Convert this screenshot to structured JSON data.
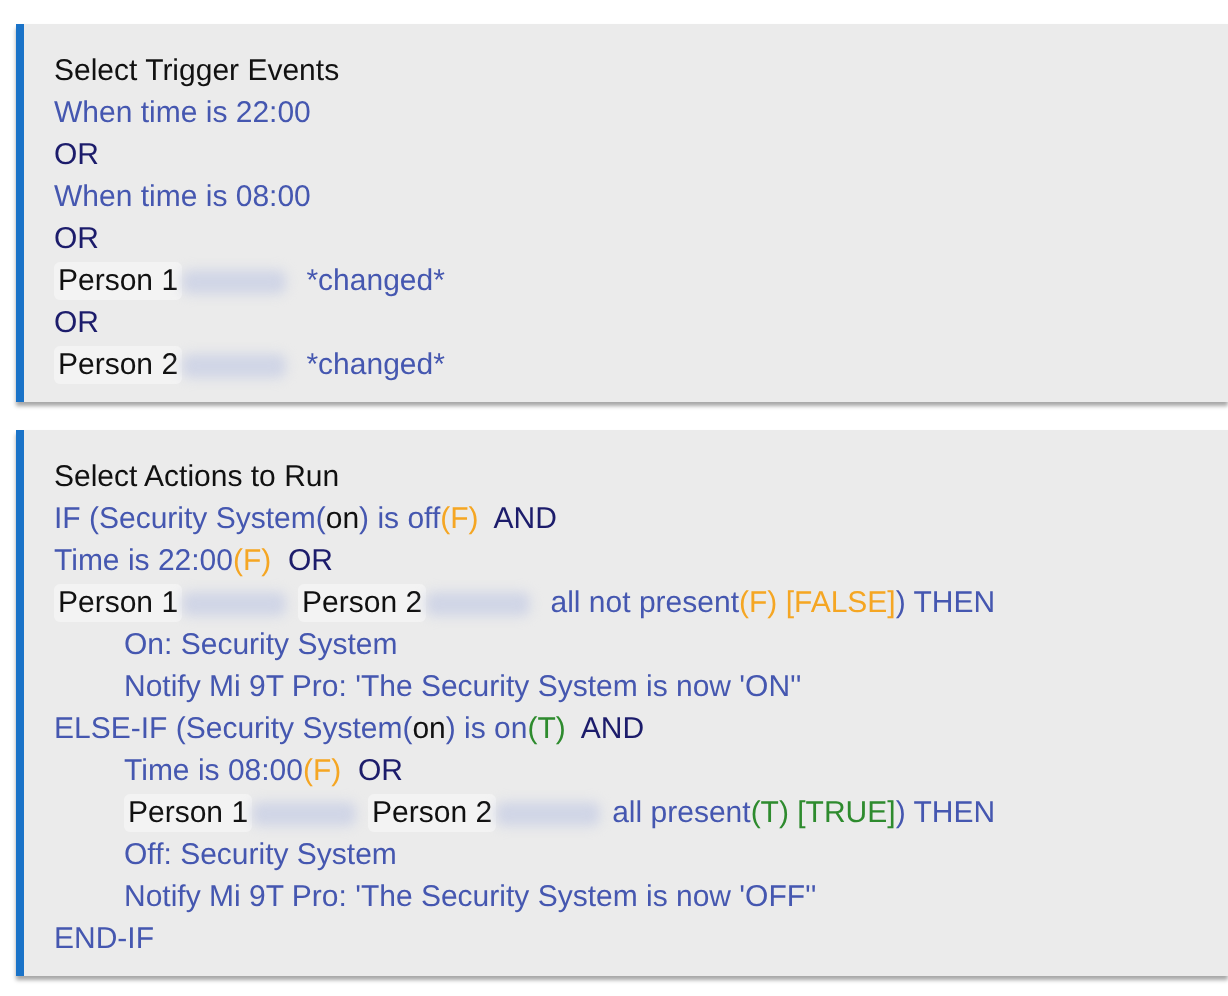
{
  "panels": [
    {
      "title": "Select Trigger Events",
      "lines": [
        {
          "indented": false,
          "segments": [
            {
              "kind": "text",
              "text": "When time is 22:00"
            }
          ]
        },
        {
          "indented": false,
          "segments": [
            {
              "kind": "op",
              "text": "OR"
            }
          ]
        },
        {
          "indented": false,
          "segments": [
            {
              "kind": "text",
              "text": "When time is 08:00"
            }
          ]
        },
        {
          "indented": false,
          "segments": [
            {
              "kind": "op",
              "text": "OR"
            }
          ]
        },
        {
          "indented": false,
          "segments": [
            {
              "kind": "person",
              "text": "Person 1"
            },
            {
              "kind": "redacted"
            },
            {
              "kind": "text",
              "text": " *changed*"
            }
          ]
        },
        {
          "indented": false,
          "segments": [
            {
              "kind": "op",
              "text": "OR"
            }
          ]
        },
        {
          "indented": false,
          "segments": [
            {
              "kind": "person",
              "text": "Person 2"
            },
            {
              "kind": "redacted"
            },
            {
              "kind": "text",
              "text": " *changed*"
            }
          ]
        }
      ]
    },
    {
      "title": "Select Actions to Run",
      "lines": [
        {
          "indented": false,
          "segments": [
            {
              "kind": "text",
              "text": "IF (Security System("
            },
            {
              "kind": "value",
              "text": "on"
            },
            {
              "kind": "text",
              "text": ") is off"
            },
            {
              "kind": "false",
              "text": "(F)"
            },
            {
              "kind": "op",
              "text": "  AND"
            }
          ]
        },
        {
          "indented": false,
          "segments": [
            {
              "kind": "text",
              "text": "Time is 22:00"
            },
            {
              "kind": "false",
              "text": "(F)"
            },
            {
              "kind": "op",
              "text": "  OR"
            }
          ]
        },
        {
          "indented": false,
          "segments": [
            {
              "kind": "person",
              "text": "Person 1"
            },
            {
              "kind": "redacted"
            },
            {
              "kind": "person",
              "text": "Person 2"
            },
            {
              "kind": "redacted"
            },
            {
              "kind": "text",
              "text": " all not present"
            },
            {
              "kind": "false",
              "text": "(F) [FALSE]"
            },
            {
              "kind": "text",
              "text": ") THEN"
            }
          ]
        },
        {
          "indented": true,
          "segments": [
            {
              "kind": "text",
              "text": "On: Security System"
            }
          ]
        },
        {
          "indented": true,
          "segments": [
            {
              "kind": "text",
              "text": "Notify Mi 9T Pro: 'The Security System is now 'ON''"
            }
          ]
        },
        {
          "indented": false,
          "segments": [
            {
              "kind": "text",
              "text": "ELSE-IF (Security System("
            },
            {
              "kind": "value",
              "text": "on"
            },
            {
              "kind": "text",
              "text": ") is on"
            },
            {
              "kind": "true",
              "text": "(T)"
            },
            {
              "kind": "op",
              "text": "  AND"
            }
          ]
        },
        {
          "indented": true,
          "segments": [
            {
              "kind": "text",
              "text": "Time is 08:00"
            },
            {
              "kind": "false",
              "text": "(F)"
            },
            {
              "kind": "op",
              "text": "  OR"
            }
          ]
        },
        {
          "indented": true,
          "segments": [
            {
              "kind": "person",
              "text": "Person 1"
            },
            {
              "kind": "redacted"
            },
            {
              "kind": "person",
              "text": "Person 2"
            },
            {
              "kind": "redacted"
            },
            {
              "kind": "text",
              "text": "all present"
            },
            {
              "kind": "true",
              "text": "(T) [TRUE]"
            },
            {
              "kind": "text",
              "text": ") THEN"
            }
          ]
        },
        {
          "indented": true,
          "segments": [
            {
              "kind": "text",
              "text": "Off: Security System"
            }
          ]
        },
        {
          "indented": true,
          "segments": [
            {
              "kind": "text",
              "text": "Notify Mi 9T Pro: 'The Security System is now 'OFF''"
            }
          ]
        },
        {
          "indented": false,
          "segments": [
            {
              "kind": "text",
              "text": "END-IF"
            }
          ]
        }
      ]
    }
  ]
}
